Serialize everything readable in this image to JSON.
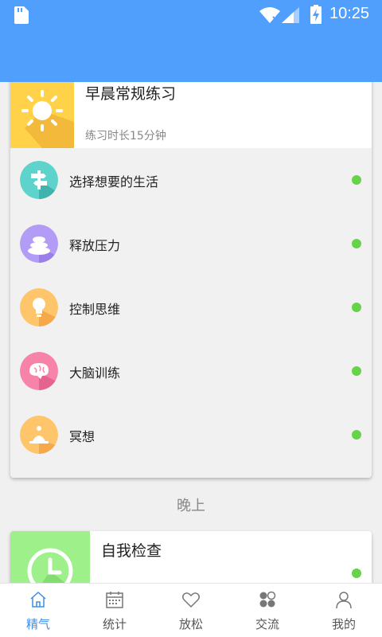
{
  "status_bar": {
    "time": "10:25"
  },
  "morning_card": {
    "title": "早晨常规练习",
    "subtitle": "练习时长15分钟",
    "items": [
      {
        "label": "选择想要的生活",
        "icon": "signpost-icon",
        "color": "#5ed3cc"
      },
      {
        "label": "释放压力",
        "icon": "stones-icon",
        "color": "#b39cf5"
      },
      {
        "label": "控制思维",
        "icon": "lightbulb-icon",
        "color": "#ffc56b"
      },
      {
        "label": "大脑训练",
        "icon": "brain-icon",
        "color": "#f783a9"
      },
      {
        "label": "冥想",
        "icon": "meditation-icon",
        "color": "#ffc56b"
      }
    ]
  },
  "evening_section": {
    "title": "晚上",
    "card_title": "自我检查"
  },
  "bottom_nav": [
    {
      "label": "精气",
      "icon": "home-icon",
      "active": true
    },
    {
      "label": "统计",
      "icon": "calendar-icon",
      "active": false
    },
    {
      "label": "放松",
      "icon": "heart-icon",
      "active": false
    },
    {
      "label": "交流",
      "icon": "community-icon",
      "active": false
    },
    {
      "label": "我的",
      "icon": "profile-icon",
      "active": false
    }
  ],
  "colors": {
    "primary": "#519ffd",
    "status_dot": "#66d34a",
    "sun_tile": "#ffd24a",
    "clock_tile": "#9ef08a"
  }
}
